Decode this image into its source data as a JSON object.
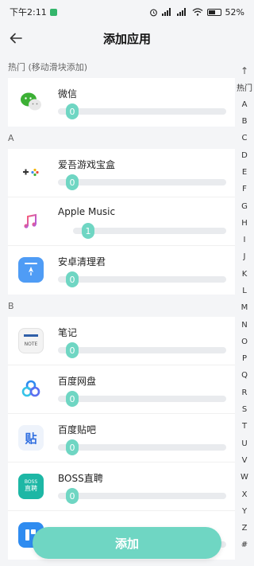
{
  "status": {
    "time": "下午2:11",
    "battery": "52%"
  },
  "header": {
    "title": "添加应用"
  },
  "sections": [
    {
      "title": "热门 (移动滑块添加)",
      "apps": [
        {
          "name": "微信",
          "value": "0",
          "icon": "wechat-icon"
        }
      ]
    },
    {
      "title": "A",
      "apps": [
        {
          "name": "爱吾游戏宝盒",
          "value": "0",
          "icon": "game-box-icon"
        },
        {
          "name": "Apple Music",
          "value": "1",
          "icon": "music-note-icon"
        },
        {
          "name": "安卓清理君",
          "value": "0",
          "icon": "rocket-icon"
        }
      ]
    },
    {
      "title": "B",
      "apps": [
        {
          "name": "笔记",
          "value": "0",
          "icon": "note-icon"
        },
        {
          "name": "百度网盘",
          "value": "0",
          "icon": "baidu-cloud-icon"
        },
        {
          "name": "百度贴吧",
          "value": "0",
          "icon": "tieba-icon"
        },
        {
          "name": "BOSS直聘",
          "value": "0",
          "icon": "boss-icon"
        },
        {
          "name": "",
          "value": "0",
          "icon": "blue-app-icon"
        }
      ]
    }
  ],
  "icon_text": {
    "note": "NOTE",
    "tieba": "贴",
    "boss_top": "BOSS",
    "boss_bottom": "直聘"
  },
  "index": [
    "↑",
    "热门",
    "A",
    "B",
    "C",
    "D",
    "E",
    "F",
    "G",
    "H",
    "I",
    "J",
    "K",
    "L",
    "M",
    "N",
    "O",
    "P",
    "Q",
    "R",
    "S",
    "T",
    "U",
    "V",
    "W",
    "X",
    "Y",
    "Z",
    "#"
  ],
  "add_button": {
    "label": "添加"
  },
  "colors": {
    "accent": "#6fd6c3",
    "background": "#f4f5f7"
  }
}
